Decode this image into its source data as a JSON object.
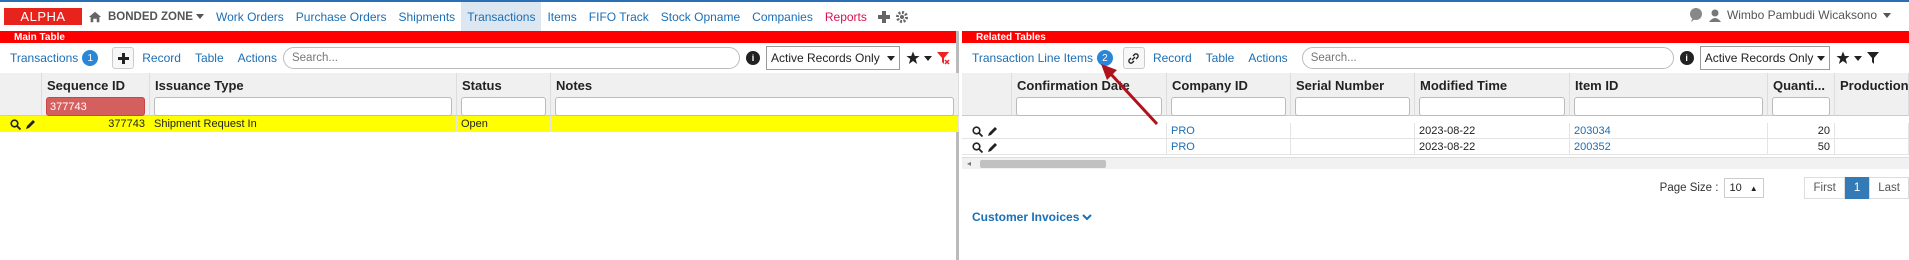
{
  "nav": {
    "brand": "ALPHA",
    "zone": "BONDED ZONE",
    "links": [
      "Work Orders",
      "Purchase Orders",
      "Shipments",
      "Transactions",
      "Items",
      "FIFO Track",
      "Stock Opname",
      "Companies",
      "Reports"
    ],
    "active": "Transactions",
    "user": "Wimbo Pambudi Wicaksono"
  },
  "left": {
    "title": "Main Table",
    "toolbar": {
      "tab_label": "Transactions",
      "count": "1",
      "record": "Record",
      "table": "Table",
      "actions": "Actions",
      "search_placeholder": "Search...",
      "filter_select": "Active Records Only"
    },
    "columns": [
      "Sequence ID",
      "Issuance Type",
      "Status",
      "Notes"
    ],
    "filter_value": "377743",
    "rows": [
      {
        "seq": "377743",
        "type": "Shipment Request In",
        "status": "Open",
        "notes": ""
      }
    ]
  },
  "right": {
    "title": "Related Tables",
    "toolbar": {
      "tab_label": "Transaction Line Items",
      "count": "2",
      "record": "Record",
      "table": "Table",
      "actions": "Actions",
      "search_placeholder": "Search...",
      "filter_select": "Active Records Only"
    },
    "columns": [
      "Confirmation Date",
      "Company ID",
      "Serial Number",
      "Modified Time",
      "Item ID",
      "Quanti...",
      "Production"
    ],
    "rows": [
      {
        "conf": "",
        "company": "PRO",
        "serial": "",
        "modified": "2023-08-22",
        "item": "203034",
        "qty": "20"
      },
      {
        "conf": "",
        "company": "PRO",
        "serial": "",
        "modified": "2023-08-22",
        "item": "200352",
        "qty": "50"
      }
    ],
    "pager": {
      "page_size_label": "Page Size :",
      "page_size": "10",
      "first": "First",
      "current": "1",
      "last": "Last"
    },
    "customer_invoices": "Customer Invoices"
  },
  "colors": {
    "accent": "#ff0000",
    "link": "#1a6fb5",
    "highlight_row": "#ffff00"
  }
}
